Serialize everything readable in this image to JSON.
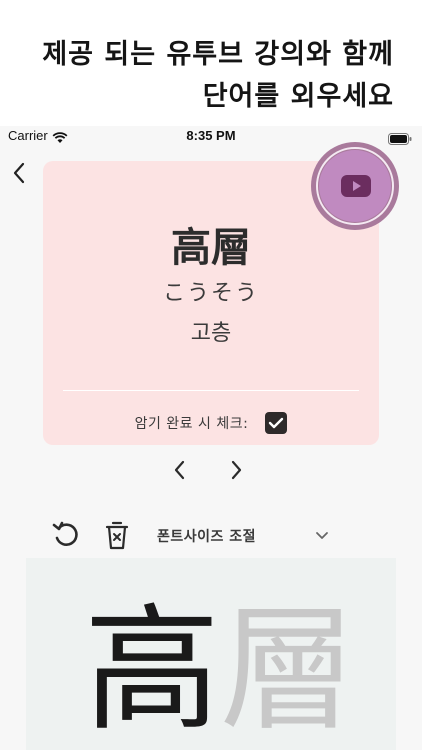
{
  "promo": {
    "line1": "제공 되는 유투브 강의와 함께",
    "line2": "단어를 외우세요"
  },
  "status_bar": {
    "carrier": "Carrier",
    "time": "8:35 PM"
  },
  "card": {
    "kanji": "高層",
    "kana": "こうそう",
    "korean": "고층",
    "memorized_label": "암기 완료 시 체크:",
    "memorized_checked": true
  },
  "toolbar": {
    "font_size_label": "폰트사이즈 조절"
  },
  "writing": {
    "first_char": "高",
    "second_char": "層"
  },
  "icons": {
    "back": "chevron-left-icon",
    "youtube": "youtube-icon",
    "prev": "chevron-left-icon",
    "next": "chevron-right-icon",
    "undo": "undo-icon",
    "trash": "trash-icon",
    "dropdown": "chevron-down-icon"
  },
  "colors": {
    "card_bg": "#fce3e3",
    "youtube_button": "#c08ac0",
    "youtube_ring": "#a97a9c",
    "youtube_icon": "#6b2d5f"
  }
}
